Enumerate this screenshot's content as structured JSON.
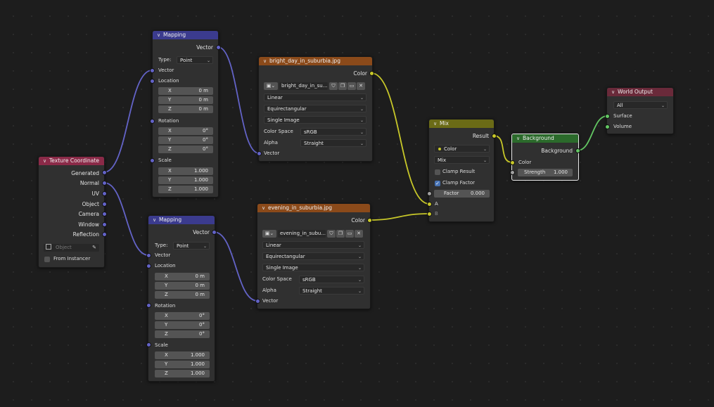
{
  "colors": {
    "vector_socket": "#6363c7",
    "color_socket": "#c7c729",
    "float_socket": "#a1a1a1",
    "shader_socket": "#63c763",
    "vector_header": "#3b3b8e",
    "texture_header": "#8b4a1a",
    "input_header": "#8b2a48",
    "color_header": "#6b6b16",
    "shader_header": "#2b6a2b",
    "output_header": "#6a2a3a"
  },
  "texcoord": {
    "title": "Texture Coordinate",
    "outputs": [
      "Generated",
      "Normal",
      "UV",
      "Object",
      "Camera",
      "Window",
      "Reflection"
    ],
    "object_placeholder": "Object",
    "from_instancer": "From Instancer"
  },
  "mapping1": {
    "title": "Mapping",
    "out_vector": "Vector",
    "type_label": "Type:",
    "type_value": "Point",
    "in_vector": "Vector",
    "location": "Location",
    "loc": [
      {
        "l": "X",
        "v": "0 m"
      },
      {
        "l": "Y",
        "v": "0 m"
      },
      {
        "l": "Z",
        "v": "0 m"
      }
    ],
    "rotation": "Rotation",
    "rot": [
      {
        "l": "X",
        "v": "0°"
      },
      {
        "l": "Y",
        "v": "0°"
      },
      {
        "l": "Z",
        "v": "0°"
      }
    ],
    "scale": "Scale",
    "scl": [
      {
        "l": "X",
        "v": "1.000"
      },
      {
        "l": "Y",
        "v": "1.000"
      },
      {
        "l": "Z",
        "v": "1.000"
      }
    ]
  },
  "mapping2": {
    "title": "Mapping",
    "out_vector": "Vector",
    "type_label": "Type:",
    "type_value": "Point",
    "in_vector": "Vector",
    "location": "Location",
    "loc": [
      {
        "l": "X",
        "v": "0 m"
      },
      {
        "l": "Y",
        "v": "0 m"
      },
      {
        "l": "Z",
        "v": "0 m"
      }
    ],
    "rotation": "Rotation",
    "rot": [
      {
        "l": "X",
        "v": "0°"
      },
      {
        "l": "Y",
        "v": "0°"
      },
      {
        "l": "Z",
        "v": "0°"
      }
    ],
    "scale": "Scale",
    "scl": [
      {
        "l": "X",
        "v": "1.000"
      },
      {
        "l": "Y",
        "v": "1.000"
      },
      {
        "l": "Z",
        "v": "1.000"
      }
    ]
  },
  "img1": {
    "title": "bright_day_in_suburbia.jpg",
    "out_color": "Color",
    "image_name": "bright_day_in_su...",
    "interpolation": "Linear",
    "projection": "Equirectangular",
    "source": "Single Image",
    "color_space_label": "Color Space",
    "color_space": "sRGB",
    "alpha_label": "Alpha",
    "alpha": "Straight",
    "in_vector": "Vector"
  },
  "img2": {
    "title": "evening_in_suburbia.jpg",
    "out_color": "Color",
    "image_name": "evening_in_subu...",
    "interpolation": "Linear",
    "projection": "Equirectangular",
    "source": "Single Image",
    "color_space_label": "Color Space",
    "color_space": "sRGB",
    "alpha_label": "Alpha",
    "alpha": "Straight",
    "in_vector": "Vector"
  },
  "mix": {
    "title": "Mix",
    "out_result": "Result",
    "data_type": "Color",
    "blend_mode": "Mix",
    "clamp_result": "Clamp Result",
    "clamp_result_checked": false,
    "clamp_factor": "Clamp Factor",
    "clamp_factor_checked": true,
    "factor_label": "Factor",
    "factor_value": "0.000",
    "in_a": "A",
    "in_b": "B"
  },
  "background": {
    "title": "Background",
    "out_background": "Background",
    "in_color": "Color",
    "strength_label": "Strength",
    "strength_value": "1.000"
  },
  "world_output": {
    "title": "World Output",
    "target": "All",
    "surface": "Surface",
    "volume": "Volume"
  }
}
